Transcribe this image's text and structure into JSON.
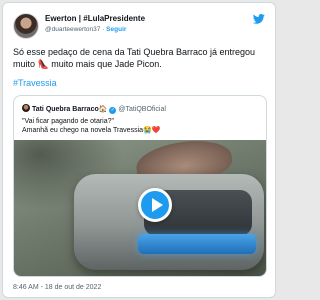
{
  "tweet": {
    "display_name": "Ewerton | #LulaPresidente",
    "handle": "@duarteewerton37",
    "separator": " · ",
    "follow_label": "Seguir",
    "text": "Só esse pedaço de cena da Tati Quebra Barraco já entregou muito 👠 muito mais que Jade Picon.",
    "hashtag": "#Travessia",
    "timestamp": "8:46 AM - 18 de out de 2022",
    "brand_color": "#1d9bf0"
  },
  "quoted": {
    "display_name": "Tati Quebra Barraco🏠",
    "verified_icon": "verified-badge-icon",
    "handle": "@TatiQBOficial",
    "line1": "\"Vai ficar pagando de otaria?\"",
    "line2": "Amanhã eu chego na novela Travessia😭❤️"
  },
  "media": {
    "type": "video",
    "play_icon": "play-icon"
  }
}
